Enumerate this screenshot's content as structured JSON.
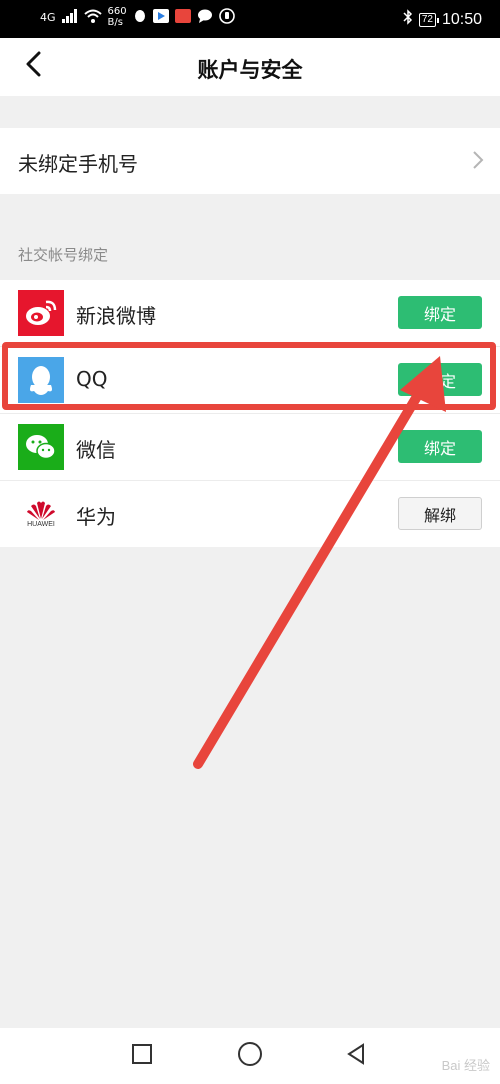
{
  "status_bar": {
    "network": "4G",
    "speed_value": "660",
    "speed_unit": "B/s",
    "battery": "72",
    "time": "10:50"
  },
  "header": {
    "title": "账户与安全"
  },
  "phone": {
    "label": "未绑定手机号"
  },
  "social_section": {
    "label": "社交帐号绑定",
    "items": [
      {
        "name": "新浪微博",
        "action": "绑定",
        "icon": "weibo-icon",
        "color": "#e6162d"
      },
      {
        "name": "QQ",
        "action": "绑定",
        "icon": "qq-icon",
        "color": "#4aa6e8"
      },
      {
        "name": "微信",
        "action": "绑定",
        "icon": "wechat-icon",
        "color": "#1aad19"
      },
      {
        "name": "华为",
        "action": "解绑",
        "icon": "huawei-icon",
        "color": "#cf0a2c"
      }
    ]
  },
  "huawei_logo_text": "HUAWEI",
  "colors": {
    "accent_green": "#2dbd73",
    "annotation_red": "#e8453c"
  },
  "watermark": "Bai 经验"
}
